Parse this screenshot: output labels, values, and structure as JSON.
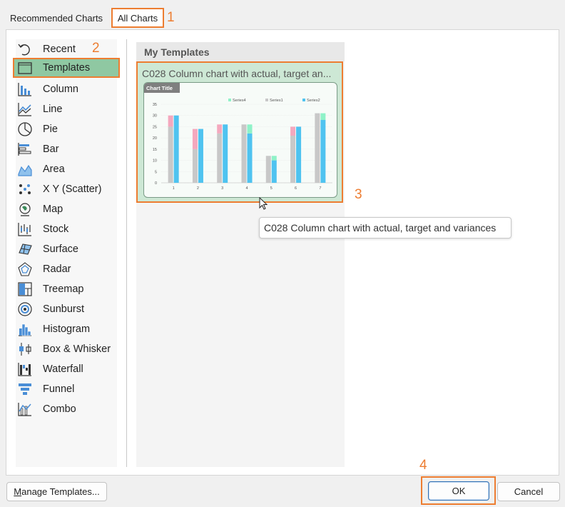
{
  "tabs": {
    "recommended": "Recommended Charts",
    "all": "All Charts"
  },
  "annotations": [
    "1",
    "2",
    "3",
    "4"
  ],
  "sidebar": {
    "items": [
      {
        "label": "Recent",
        "icon": "recent-icon"
      },
      {
        "label": "Templates",
        "icon": "folder-icon"
      },
      {
        "label": "Column",
        "icon": "column-chart-icon"
      },
      {
        "label": "Line",
        "icon": "line-chart-icon"
      },
      {
        "label": "Pie",
        "icon": "pie-chart-icon"
      },
      {
        "label": "Bar",
        "icon": "bar-chart-icon"
      },
      {
        "label": "Area",
        "icon": "area-chart-icon"
      },
      {
        "label": "X Y (Scatter)",
        "icon": "scatter-chart-icon"
      },
      {
        "label": "Map",
        "icon": "map-chart-icon"
      },
      {
        "label": "Stock",
        "icon": "stock-chart-icon"
      },
      {
        "label": "Surface",
        "icon": "surface-chart-icon"
      },
      {
        "label": "Radar",
        "icon": "radar-chart-icon"
      },
      {
        "label": "Treemap",
        "icon": "treemap-chart-icon"
      },
      {
        "label": "Sunburst",
        "icon": "sunburst-chart-icon"
      },
      {
        "label": "Histogram",
        "icon": "histogram-chart-icon"
      },
      {
        "label": "Box & Whisker",
        "icon": "box-whisker-chart-icon"
      },
      {
        "label": "Waterfall",
        "icon": "waterfall-chart-icon"
      },
      {
        "label": "Funnel",
        "icon": "funnel-chart-icon"
      },
      {
        "label": "Combo",
        "icon": "combo-chart-icon"
      }
    ],
    "selected": "Templates"
  },
  "content": {
    "header": "My Templates",
    "template_title": "C028 Column chart with actual, target an...",
    "tooltip": "C028 Column chart with actual, target and variances"
  },
  "chart_data": {
    "type": "bar",
    "title": "Chart Title",
    "categories": [
      "1",
      "2",
      "3",
      "4",
      "5",
      "6",
      "7"
    ],
    "ylim": [
      0,
      35
    ],
    "yticks": [
      "0",
      "5",
      "10",
      "15",
      "20",
      "25",
      "30",
      "35"
    ],
    "legend": [
      "Series4",
      "Series1",
      "Series2"
    ],
    "series": [
      {
        "name": "Series1",
        "values": [
          25,
          15,
          22,
          26,
          12,
          21,
          31
        ]
      },
      {
        "name": "Series2",
        "values": [
          30,
          24,
          26,
          22,
          10,
          25,
          28
        ]
      },
      {
        "name": "Series4",
        "values": [
          0,
          0,
          0,
          4,
          2,
          0,
          3
        ]
      },
      {
        "values": [
          5,
          9,
          4,
          0,
          0,
          4,
          0
        ]
      }
    ],
    "colors": {
      "Series1": "#c8c8c8",
      "Series2": "#4fc3f0",
      "Series4": "#8ff2c8",
      "neg": "#f4a8be"
    }
  },
  "buttons": {
    "manage_prefix": "M",
    "manage_rest": "anage Templates...",
    "ok": "OK",
    "cancel": "Cancel"
  },
  "colors": {
    "highlight": "#ed7d31",
    "selected_bg": "#8fc8a2"
  }
}
